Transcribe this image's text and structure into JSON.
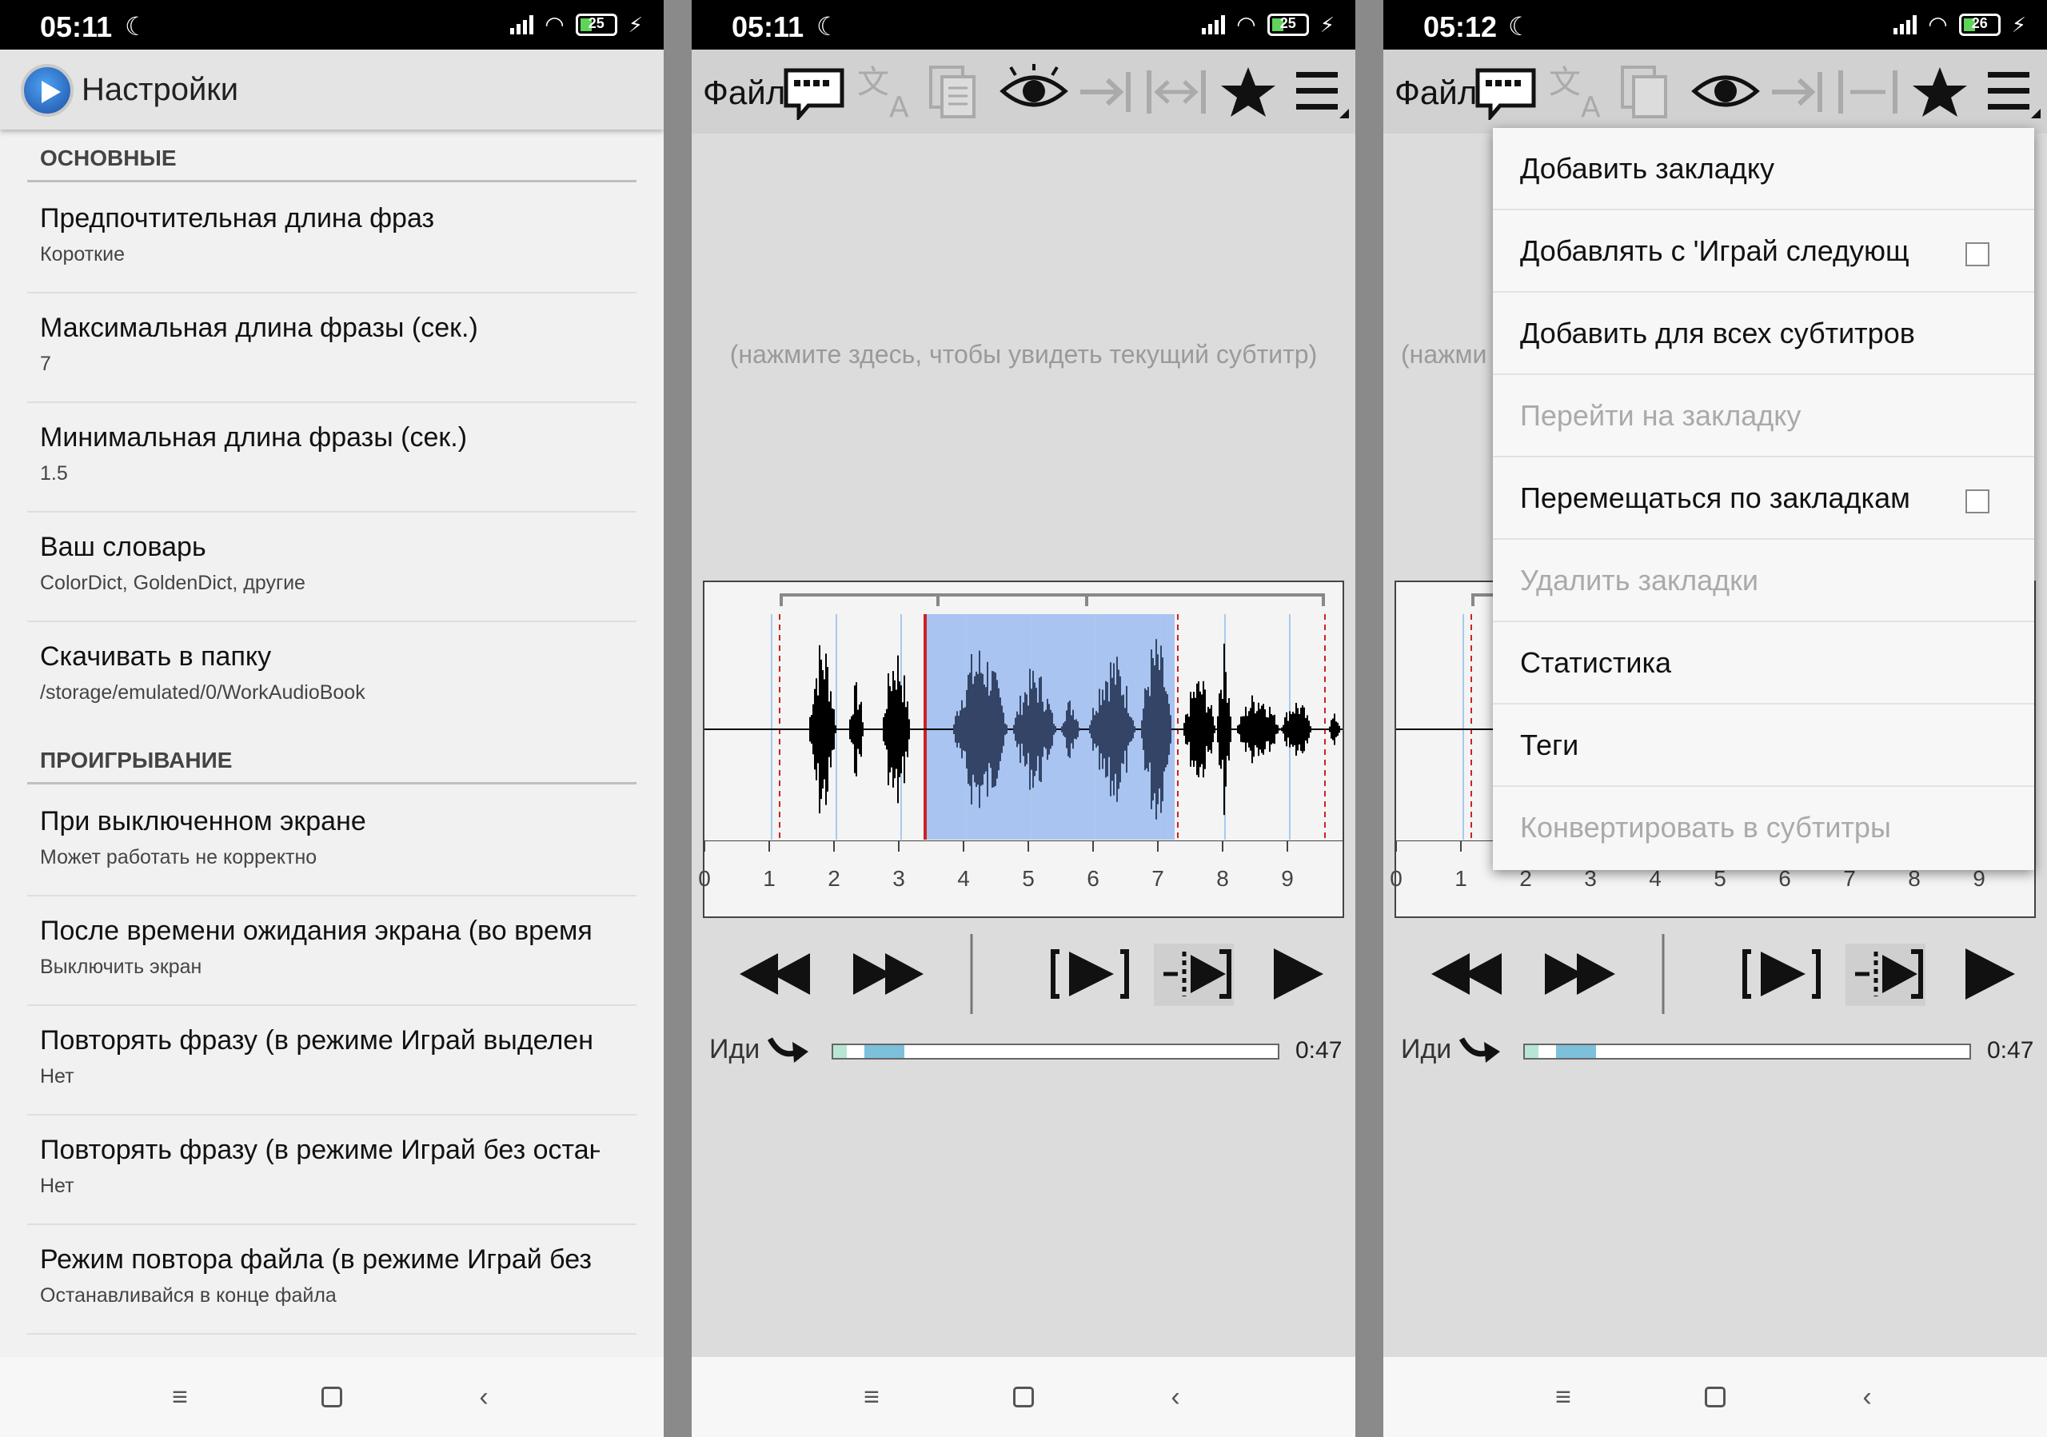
{
  "screens": [
    {
      "status": {
        "time": "05:11",
        "battery": "25"
      }
    },
    {
      "status": {
        "time": "05:11",
        "battery": "25"
      }
    },
    {
      "status": {
        "time": "05:12",
        "battery": "26"
      }
    }
  ],
  "settings": {
    "title": "Настройки",
    "section_basic": "ОСНОВНЫЕ",
    "section_playback": "ПРОИГРЫВАНИЕ",
    "items": [
      {
        "title": "Предпочтительная длина фраз",
        "summary": "Короткие"
      },
      {
        "title": "Максимальная длина фразы (сек.)",
        "summary": "7"
      },
      {
        "title": "Минимальная длина фразы (сек.)",
        "summary": "1.5"
      },
      {
        "title": "Ваш словарь",
        "summary": "ColorDict, GoldenDict, другие"
      },
      {
        "title": "Скачивать в папку",
        "summary": "/storage/emulated/0/WorkAudioBook"
      },
      {
        "title": "При выключенном экране",
        "summary": "Может работать не корректно"
      },
      {
        "title": "После времени ожидания экрана (во время",
        "summary": "Выключить экран"
      },
      {
        "title": "Повторять фразу (в режиме Играй выделен",
        "summary": "Нет"
      },
      {
        "title": "Повторять фразу (в режиме Играй без остан",
        "summary": "Нет"
      },
      {
        "title": "Режим повтора файла (в режиме Играй без",
        "summary": "Останавливайся в конце файла"
      }
    ]
  },
  "player": {
    "file_label": "Файл",
    "subtitle_hint": "(нажмите здесь, чтобы увидеть текущий субтитр)",
    "subtitle_hint_cut": "(нажми",
    "tick_labels": [
      "0",
      "1",
      "2",
      "3",
      "4",
      "5",
      "6",
      "7",
      "8",
      "9"
    ],
    "go_label": "Иди",
    "duration": "0:47",
    "progress": {
      "played_fraction": 0.03,
      "selection_start": 0.07,
      "selection_end": 0.16
    },
    "toolbar_icons": [
      "subtitles-icon",
      "translate-icon",
      "copy-icon",
      "eye-icon",
      "arrow-right-bar-icon",
      "expand-icon",
      "star-icon",
      "menu-icon"
    ]
  },
  "menu": {
    "items": [
      {
        "label": "Добавить закладку",
        "enabled": true,
        "checkbox": false
      },
      {
        "label": "Добавлять с 'Играй следующ",
        "enabled": true,
        "checkbox": true
      },
      {
        "label": "Добавить для всех субтитров",
        "enabled": true,
        "checkbox": false
      },
      {
        "label": "Перейти на закладку",
        "enabled": false,
        "checkbox": false
      },
      {
        "label": "Перемещаться по закладкам",
        "enabled": true,
        "checkbox": true
      },
      {
        "label": "Удалить закладки",
        "enabled": false,
        "checkbox": false
      },
      {
        "label": "Статистика",
        "enabled": true,
        "checkbox": false
      },
      {
        "label": "Теги",
        "enabled": true,
        "checkbox": false
      },
      {
        "label": "Конвертировать в субтитры",
        "enabled": false,
        "checkbox": false
      }
    ]
  },
  "colors": {
    "selection": "#a9c4f0",
    "waveform": "#000000",
    "accent": "#cc2222"
  }
}
